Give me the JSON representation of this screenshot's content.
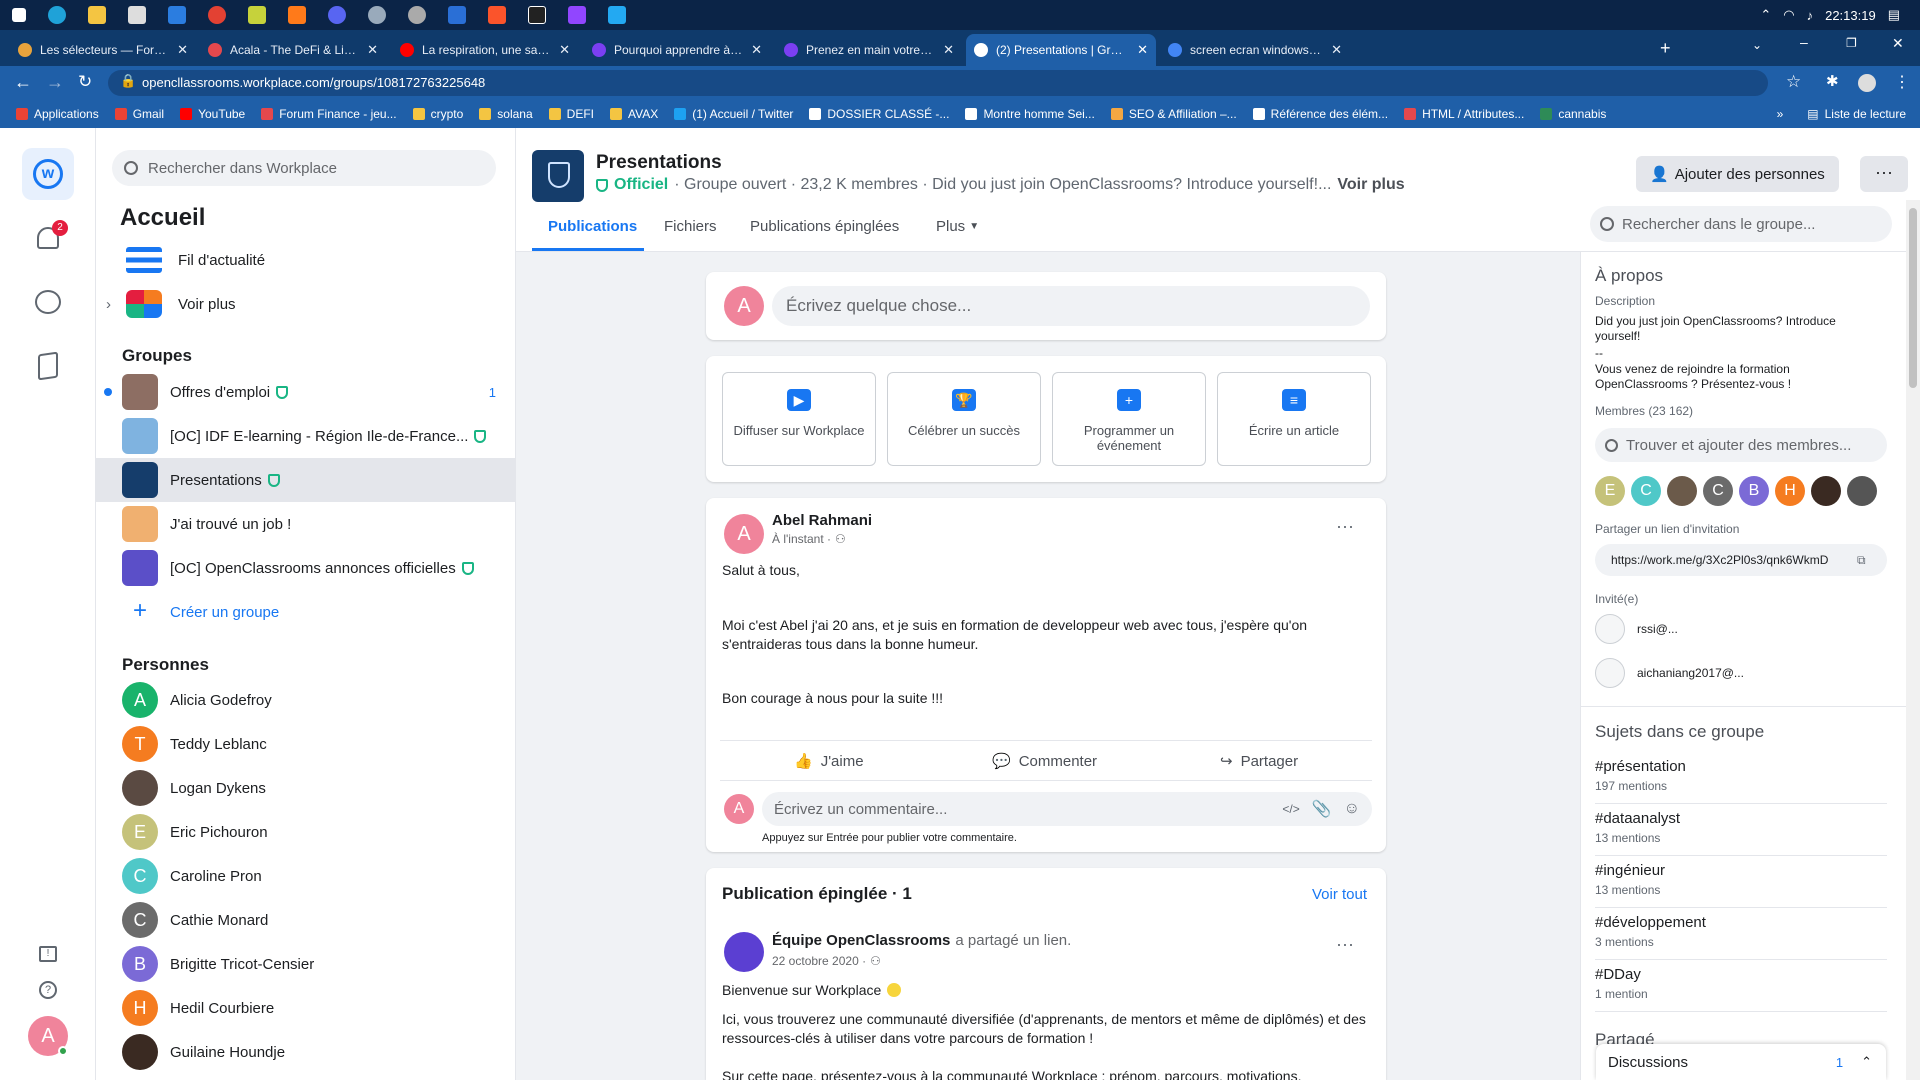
{
  "taskbar": {
    "time": "22:13:19"
  },
  "tabs": [
    {
      "title": "Les sélecteurs — Formation Déc",
      "color": "#e8a33c"
    },
    {
      "title": "Acala - The DeFi & Liquidity Hub",
      "color": "#e5484d"
    },
    {
      "title": "La respiration, une savante méc",
      "color": "#ff0000"
    },
    {
      "title": "Pourquoi apprendre à apprendre",
      "color": "#7b3ff2"
    },
    {
      "title": "Prenez en main votre formation",
      "color": "#7b3ff2"
    },
    {
      "title": "(2) Presentations | Groupe | Wor",
      "color": "#ffffff"
    },
    {
      "title": "screen ecran windows - Recherc",
      "color": "#4285f4"
    }
  ],
  "address": {
    "url": "opencllassrooms.workplace.com/groups/108172763225648"
  },
  "bookmarks": [
    {
      "label": "Applications",
      "color": "#ea4335"
    },
    {
      "label": "Gmail",
      "color": "#ea4335"
    },
    {
      "label": "YouTube",
      "color": "#ff0000"
    },
    {
      "label": "Forum Finance - jeu...",
      "color": "#e5484d"
    },
    {
      "label": "crypto",
      "color": "#f4c542"
    },
    {
      "label": "solana",
      "color": "#f4c542"
    },
    {
      "label": "DEFI",
      "color": "#f4c542"
    },
    {
      "label": "AVAX",
      "color": "#f4c542"
    },
    {
      "label": "(1) Accueil / Twitter",
      "color": "#1da1f2"
    },
    {
      "label": "DOSSIER CLASSÉ -...",
      "color": "#ffffff"
    },
    {
      "label": "Montre homme Sei...",
      "color": "#ffffff"
    },
    {
      "label": "SEO & Affiliation –...",
      "color": "#f4a742"
    },
    {
      "label": "Référence des élém...",
      "color": "#ffffff"
    },
    {
      "label": "HTML / Attributes...",
      "color": "#e5484d"
    },
    {
      "label": "cannabis",
      "color": "#2e8b57"
    }
  ],
  "bookmarks_reading_list": "Liste de lecture",
  "rail": {
    "notif_count": "2",
    "user_initial": "A"
  },
  "nav": {
    "search_placeholder": "Rechercher dans Workplace",
    "title": "Accueil",
    "feed": "Fil d'actualité",
    "more": "Voir plus",
    "groups_header": "Groupes",
    "groups": [
      {
        "label": "Offres d'emploi",
        "badge": "1",
        "color": "#8d6e63"
      },
      {
        "label": "[OC] IDF E-learning - Région Ile-de-France...",
        "badge": "",
        "color": "#7fb3e0"
      },
      {
        "label": "Presentations",
        "badge": "",
        "color": "#153d6b"
      },
      {
        "label": "J'ai trouvé un job !",
        "badge": "",
        "color": "#f0b070"
      },
      {
        "label": "[OC] OpenClassrooms annonces officielles",
        "badge": "",
        "color": "#5b4fc8"
      }
    ],
    "create_group": "Créer un groupe",
    "people_header": "Personnes",
    "people": [
      {
        "name": "Alicia Godefroy",
        "initial": "A",
        "color": "#19b36b"
      },
      {
        "name": "Teddy Leblanc",
        "initial": "T",
        "color": "#f57c20"
      },
      {
        "name": "Logan Dykens",
        "initial": "",
        "color": "#5a4a42"
      },
      {
        "name": "Eric Pichouron",
        "initial": "E",
        "color": "#c5c27a"
      },
      {
        "name": "Caroline Pron",
        "initial": "C",
        "color": "#4fc8c8"
      },
      {
        "name": "Cathie Monard",
        "initial": "C",
        "color": "#6b6b6b"
      },
      {
        "name": "Brigitte Tricot-Censier",
        "initial": "B",
        "color": "#7b6ad6"
      },
      {
        "name": "Hedil Courbiere",
        "initial": "H",
        "color": "#f57c20"
      },
      {
        "name": "Guilaine Houndje",
        "initial": "",
        "color": "#3a2a22"
      }
    ]
  },
  "group": {
    "name": "Presentations",
    "official": "Officiel",
    "meta": "· Groupe ouvert · 23,2 K membres · Did you just join OpenClassrooms? Introduce yourself!...",
    "see_more": "Voir plus",
    "add_people": "Ajouter des personnes",
    "tabs": [
      "Publications",
      "Fichiers",
      "Publications épinglées",
      "Plus"
    ],
    "search_placeholder": "Rechercher dans le groupe..."
  },
  "composer": {
    "initial": "A",
    "placeholder": "Écrivez quelque chose..."
  },
  "actions": [
    "Diffuser sur Workplace",
    "Célébrer un succès",
    "Programmer un événement",
    "Écrire un article"
  ],
  "post": {
    "author": "Abel Rahmani",
    "time": "À l'instant ·",
    "initial": "A",
    "p1": "Salut à tous,",
    "p2": "Moi c'est Abel j'ai 20 ans, et je suis en formation de developpeur web avec tous, j'espère qu'on s'entraideras tous dans la bonne humeur.",
    "p3": "Bon courage à nous pour la suite !!!",
    "like": "J'aime",
    "comment": "Commenter",
    "share": "Partager",
    "comment_placeholder": "Écrivez un commentaire...",
    "hint": "Appuyez sur Entrée pour publier votre commentaire."
  },
  "pinned": {
    "header": "Publication épinglée · 1",
    "see_all": "Voir tout",
    "author": "Équipe OpenClassrooms",
    "action": "a partagé un lien.",
    "date": "22 octobre 2020 ·",
    "l1": "Bienvenue sur Workplace",
    "l2": "Ici, vous trouverez une communauté diversifiée (d'apprenants, de mentors et même de diplômés) et des ressources-clés à utiliser dans votre parcours de formation !",
    "l3": "Sur cette page, présentez-vous à la communauté Workplace : prénom, parcours, motivations,"
  },
  "about": {
    "title": "À propos",
    "desc_label": "Description",
    "desc1": "Did you just join OpenClassrooms? Introduce yourself!",
    "desc2": "--",
    "desc3": "Vous venez de rejoindre la formation OpenClassrooms ? Présentez-vous !",
    "members": "Membres (23 162)",
    "find_members": "Trouver et ajouter des membres...",
    "member_avatars": [
      {
        "initial": "E",
        "color": "#c5c27a"
      },
      {
        "initial": "C",
        "color": "#4fc8c8"
      },
      {
        "initial": "",
        "color": "#6b5a4a"
      },
      {
        "initial": "C",
        "color": "#6b6b6b"
      },
      {
        "initial": "B",
        "color": "#7b6ad6"
      },
      {
        "initial": "H",
        "color": "#f57c20"
      },
      {
        "initial": "",
        "color": "#3a2a22"
      },
      {
        "initial": "",
        "color": "#555555"
      }
    ],
    "invite_label": "Partager un lien d'invitation",
    "invite_link": "https://work.me/g/3Xc2Pl0s3/qnk6WkmD",
    "invited_label": "Invité(e)",
    "invited": [
      "rssi@...",
      "aichaniang2017@..."
    ]
  },
  "topics": {
    "title": "Sujets dans ce groupe",
    "items": [
      {
        "name": "#présentation",
        "count": "197 mentions"
      },
      {
        "name": "#dataanalyst",
        "count": "13 mentions"
      },
      {
        "name": "#ingénieur",
        "count": "13 mentions"
      },
      {
        "name": "#développement",
        "count": "3 mentions"
      },
      {
        "name": "#DDay",
        "count": "1 mention"
      }
    ],
    "next_section": "Partagé"
  },
  "discussions": {
    "label": "Discussions",
    "count": "1"
  }
}
